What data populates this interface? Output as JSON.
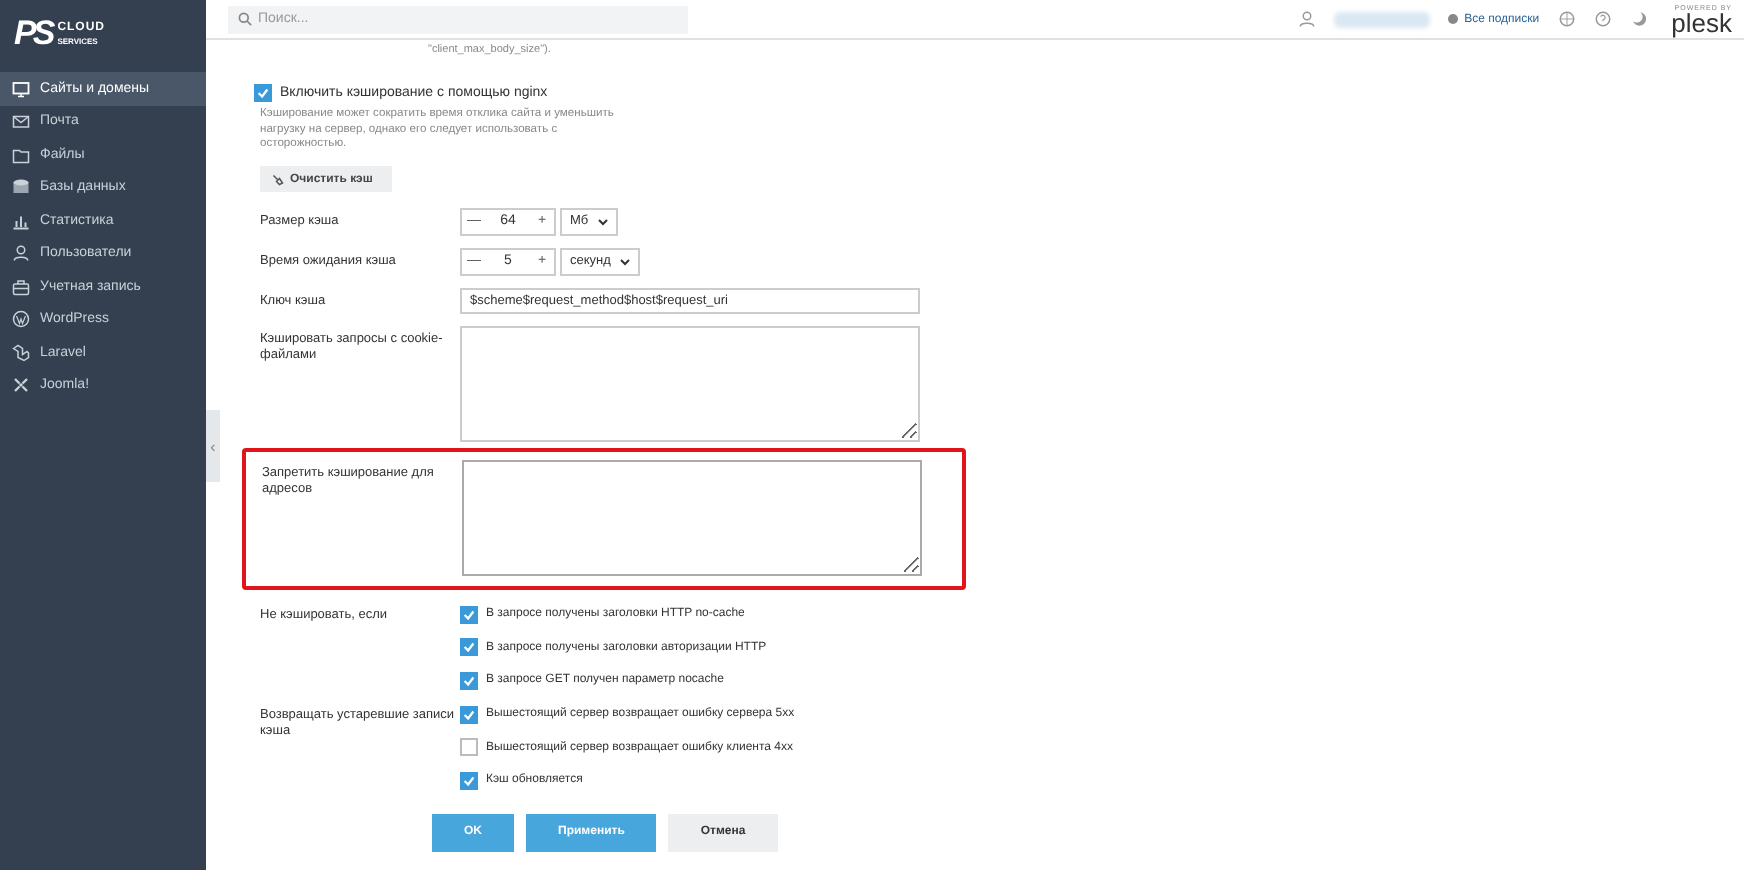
{
  "sidebar": {
    "logo": {
      "mark": "PS",
      "line1": "CLOUD",
      "line2": "SERVICES"
    },
    "items": [
      {
        "label": "Сайты и домены",
        "selected": true
      },
      {
        "label": "Почта",
        "selected": false
      },
      {
        "label": "Файлы",
        "selected": false
      },
      {
        "label": "Базы данных",
        "selected": false
      },
      {
        "label": "Статистика",
        "selected": false
      },
      {
        "label": "Пользователи",
        "selected": false
      },
      {
        "label": "Учетная запись",
        "selected": false
      },
      {
        "label": "WordPress",
        "selected": false
      },
      {
        "label": "Laravel",
        "selected": false
      },
      {
        "label": "Joomla!",
        "selected": false
      }
    ],
    "collapse": "‹"
  },
  "topbar": {
    "search": {
      "placeholder": "Поиск..."
    },
    "subscriptions": "Все подписки",
    "powered_by": "POWERED BY",
    "brand": "plesk"
  },
  "cut_note": "\"client_max_body_size\").",
  "nginx_cache": {
    "label": "Включить кэширование с помощью nginx",
    "checked": true,
    "description": "Кэширование может сократить время отклика сайта и уменьшить нагрузку на сервер, однако его следует использовать с осторожностью.",
    "clear_button": "Очистить кэш"
  },
  "fields": [
    {
      "kind": "spinner",
      "label": "Размер кэша",
      "minus": "—",
      "value": "64",
      "plus": "+",
      "unit": "Мб"
    },
    {
      "kind": "spinner",
      "label": "Время ожидания кэша",
      "minus": "—",
      "value": "5",
      "plus": "+",
      "unit": "секунд"
    },
    {
      "kind": "text",
      "label": "Ключ кэша",
      "value": "$scheme$request_method$host$request_uri"
    },
    {
      "kind": "textarea",
      "label": "Кэшировать запросы с cookie-файлами",
      "highlighted": false,
      "focused": false
    },
    {
      "kind": "textarea",
      "label": "Запретить кэширование для адресов",
      "highlighted": true,
      "focused": true
    }
  ],
  "checkgroups": [
    {
      "label": "Не кэшировать, если",
      "options": [
        {
          "label": "В запросе получены заголовки HTTP no-cache",
          "checked": true
        },
        {
          "label": "В запросе получены заголовки авторизации HTTP",
          "checked": true
        },
        {
          "label": "В запросе GET получен параметр nocache",
          "checked": true
        }
      ]
    },
    {
      "label": "Возвращать устаревшие записи кэша",
      "options": [
        {
          "label": "Вышестоящий сервер возвращает ошибку сервера 5xx",
          "checked": true
        },
        {
          "label": "Вышестоящий сервер возвращает ошибку клиента 4xx",
          "checked": false
        },
        {
          "label": "Кэш обновляется",
          "checked": true
        }
      ]
    }
  ],
  "buttons": [
    {
      "label": "OK",
      "kind": "primary"
    },
    {
      "label": "Применить",
      "kind": "primary"
    },
    {
      "label": "Отмена",
      "kind": "secondary"
    }
  ]
}
